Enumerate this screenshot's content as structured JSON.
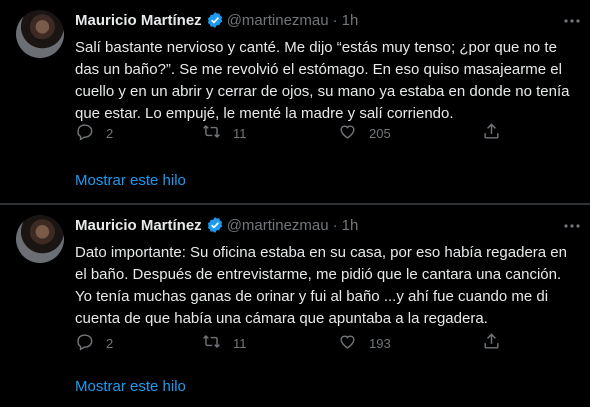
{
  "tweets": [
    {
      "author_name": "Mauricio Martínez",
      "handle": "@martinezmau",
      "dot": "·",
      "time": "1h",
      "text": "Salí bastante nervioso y canté. Me dijo “estás muy tenso; ¿por que no te das un baño?”. Se me revolvió el estómago. En eso quiso masajearme el cuello y en un abrir y cerrar de ojos, su mano ya estaba en donde no tenía que estar. Lo empujé, le menté la madre y salí corriendo.",
      "replies": "2",
      "retweets": "11",
      "likes": "205",
      "show_thread": "Mostrar este hilo"
    },
    {
      "author_name": "Mauricio Martínez",
      "handle": "@martinezmau",
      "dot": "·",
      "time": "1h",
      "text": "Dato importante: Su oficina estaba en su casa, por eso había regadera en el baño. Después de entrevistarme, me pidió que le cantara una canción. Yo tenía muchas ganas de orinar y fui al baño ...y ahí fue cuando me di cuenta de que había una cámara que apuntaba a la regadera.",
      "replies": "2",
      "retweets": "11",
      "likes": "193",
      "show_thread": "Mostrar este hilo"
    }
  ],
  "colors": {
    "background": "#000000",
    "text": "#e7e9ea",
    "secondary": "#71767b",
    "link": "#1d9bf0",
    "verified": "#1d9bf0",
    "divider": "#2f3336"
  },
  "icons": [
    "verified-badge-icon",
    "more-icon",
    "reply-icon",
    "retweet-icon",
    "like-icon",
    "share-icon"
  ]
}
